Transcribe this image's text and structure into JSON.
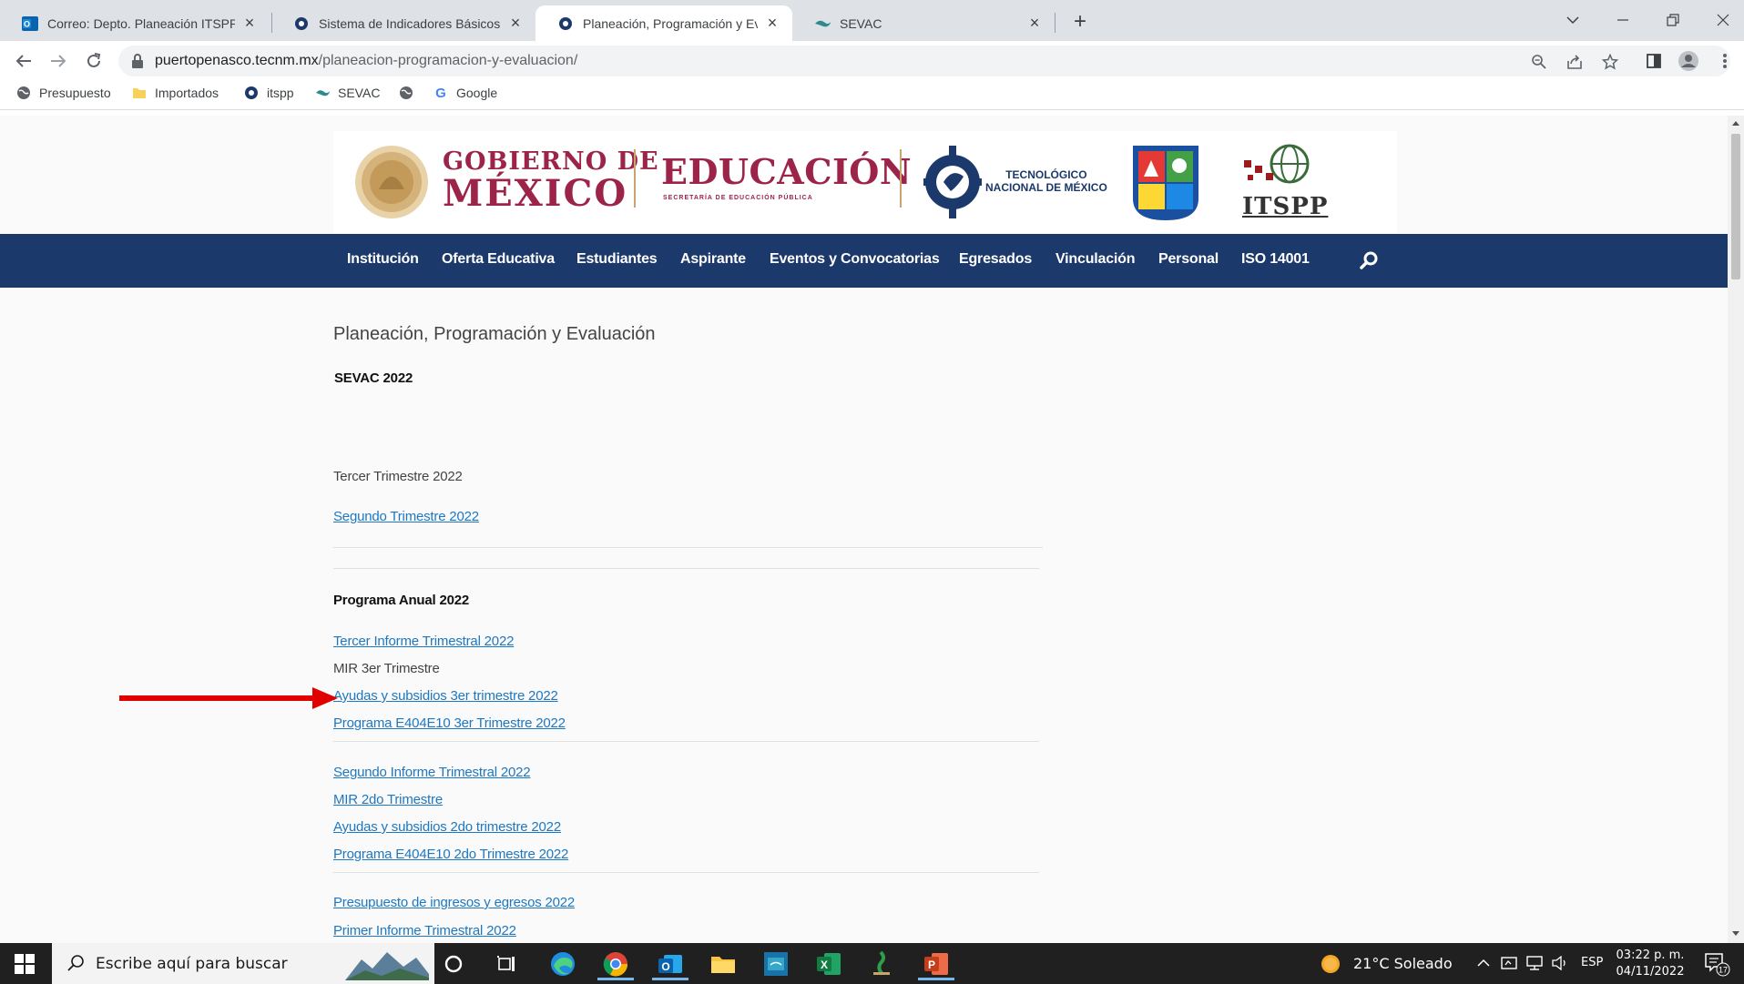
{
  "browser": {
    "tabs": [
      {
        "title": "Correo: Depto. Planeación ITSPP",
        "icon": "outlook-icon"
      },
      {
        "title": "Sistema de Indicadores Básicos",
        "icon": "tecnm-icon"
      },
      {
        "title": "Planeación, Programación y Evaluación",
        "icon": "tecnm-icon"
      },
      {
        "title": "SEVAC",
        "icon": "sevac-icon"
      }
    ],
    "active_tab": 2,
    "url_domain": "puertopenasco.tecnm.mx",
    "url_path": "/planeacion-programacion-y-evaluacion/",
    "bookmarks": [
      {
        "label": "Presupuesto",
        "icon": "globe-icon"
      },
      {
        "label": "Importados",
        "icon": "folder-icon"
      },
      {
        "label": "itspp",
        "icon": "tecnm-icon"
      },
      {
        "label": "SEVAC",
        "icon": "sevac-icon"
      },
      {
        "label": "",
        "icon": "globe-icon"
      },
      {
        "label": "Google",
        "icon": "google-icon"
      }
    ]
  },
  "header": {
    "gob_line1": "GOBIERNO DE",
    "gob_line2": "MÉXICO",
    "edu": "EDUCACIÓN",
    "edu_sub": "SECRETARÍA DE EDUCACIÓN PÚBLICA",
    "tecnm_line1": "TECNOLÓGICO",
    "tecnm_line2": "NACIONAL DE MÉXICO",
    "itspp": "ITSPP"
  },
  "nav": [
    "Institución",
    "Oferta Educativa",
    "Estudiantes",
    "Aspirante",
    "Eventos y Convocatorias",
    "Egresados",
    "Vinculación",
    "Personal",
    "ISO 14001"
  ],
  "content": {
    "page_title": "Planeación, Programación y Evaluación",
    "sevac_heading": "SEVAC 2022",
    "tercer_trimestre": "Tercer Trimestre 2022",
    "segundo_trimestre_link": "Segundo Trimestre 2022",
    "programa_heading": "Programa Anual 2022",
    "group3": {
      "informe": "Tercer Informe Trimestral 2022 ",
      "mir": "MIR 3er Trimestre",
      "ayudas": "Ayudas y subsidios 3er trimestre 2022",
      "programa": "Programa E404E10 3er Trimestre 2022"
    },
    "group2": {
      "informe": "Segundo Informe Trimestral 2022",
      "mir": "MIR 2do Trimestre",
      "ayudas": "Ayudas y subsidios 2do trimestre 2022",
      "programa": "Programa E404E10 2do Trimestre 2022"
    },
    "presupuesto": "Presupuesto de ingresos y egresos 2022",
    "primer_informe": "Primer Informe Trimestral 2022"
  },
  "taskbar": {
    "search_placeholder": "Escribe aquí para buscar",
    "weather": "21°C  Soleado",
    "language": "ESP",
    "time": "03:22 p. m.",
    "date": "04/11/2022",
    "notifications": "17"
  },
  "colors": {
    "nav_bg": "#1b396a",
    "link": "#1d78c1",
    "gob_maroon": "#9d2449",
    "annotation_arrow": "#e00000"
  }
}
